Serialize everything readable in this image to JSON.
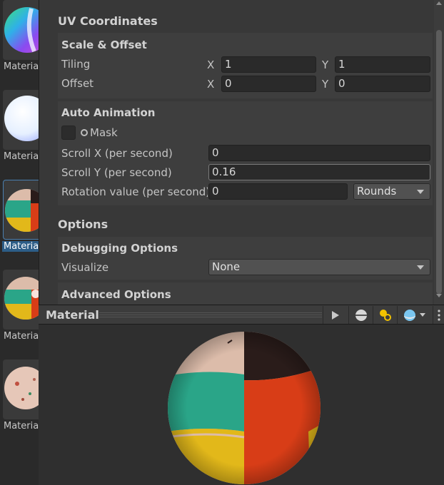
{
  "asset_strip": {
    "items": [
      {
        "label": "Materia",
        "selected": false
      },
      {
        "label": "Materia",
        "selected": false
      },
      {
        "label": "Materia",
        "selected": true
      },
      {
        "label": "Materia",
        "selected": false
      },
      {
        "label": "Materia",
        "selected": false
      }
    ]
  },
  "inspector": {
    "uv_section_title": "UV Coordinates",
    "scale_offset": {
      "title": "Scale & Offset",
      "tiling_label": "Tiling",
      "tiling_x_axis": "X",
      "tiling_x_value": "1",
      "tiling_y_axis": "Y",
      "tiling_y_value": "1",
      "offset_label": "Offset",
      "offset_x_axis": "X",
      "offset_x_value": "0",
      "offset_y_axis": "Y",
      "offset_y_value": "0"
    },
    "auto_animation": {
      "title": "Auto Animation",
      "mask_label": "Mask",
      "mask_checked": false,
      "scroll_x_label": "Scroll X (per second)",
      "scroll_x_value": "0",
      "scroll_y_label": "Scroll Y (per second)",
      "scroll_y_value": "0.16",
      "rotation_label": "Rotation value (per second)",
      "rotation_value": "0",
      "rotation_unit": "Rounds"
    },
    "options_title": "Options",
    "debugging": {
      "title": "Debugging Options",
      "visualize_label": "Visualize",
      "visualize_value": "None"
    },
    "advanced_title": "Advanced Options"
  },
  "preview": {
    "title": "Material",
    "toolbar": [
      "play-icon",
      "sphere-mesh-icon",
      "lights-icon",
      "background-sphere-icon",
      "more-icon"
    ]
  },
  "colors": {
    "panel_bg": "#383838",
    "group_bg": "#3e3e3e",
    "field_bg": "#2a2a2a",
    "selection": "#2c5d87",
    "ball_teal": "#2aa588",
    "ball_orange": "#d83d17",
    "ball_yellow": "#e2b81a",
    "ball_skin": "#dcbcaa",
    "ball_dark": "#2a1c1a"
  }
}
